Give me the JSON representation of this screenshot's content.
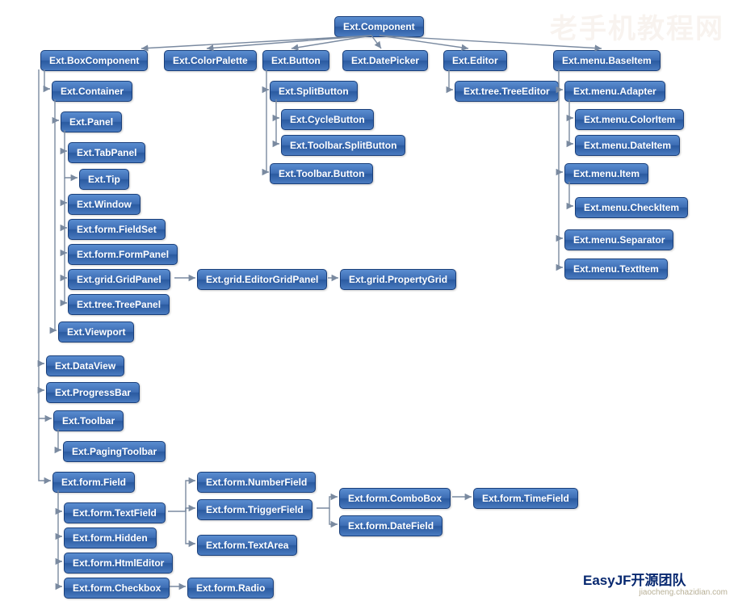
{
  "credit": "EasyJF开源团队",
  "watermark_small": "jiaocheng.chazidian.com",
  "watermark_big": "老手机教程网",
  "nodes": {
    "component": "Ext.Component",
    "boxcomponent": "Ext.BoxComponent",
    "colorpalette": "Ext.ColorPalette",
    "button": "Ext.Button",
    "datepicker": "Ext.DatePicker",
    "editor": "Ext.Editor",
    "menu_baseitem": "Ext.menu.BaseItem",
    "container": "Ext.Container",
    "panel": "Ext.Panel",
    "tabpanel": "Ext.TabPanel",
    "tip": "Ext.Tip",
    "window": "Ext.Window",
    "form_fieldset": "Ext.form.FieldSet",
    "form_formpanel": "Ext.form.FormPanel",
    "grid_gridpanel": "Ext.grid.GridPanel",
    "grid_editorgridpanel": "Ext.grid.EditorGridPanel",
    "grid_propertygrid": "Ext.grid.PropertyGrid",
    "tree_treepanel": "Ext.tree.TreePanel",
    "viewport": "Ext.Viewport",
    "splitbutton": "Ext.SplitButton",
    "cyclebutton": "Ext.CycleButton",
    "toolbar_splitbutton": "Ext.Toolbar.SplitButton",
    "toolbar_button": "Ext.Toolbar.Button",
    "tree_treeeditor": "Ext.tree.TreeEditor",
    "menu_adapter": "Ext.menu.Adapter",
    "menu_coloritem": "Ext.menu.ColorItem",
    "menu_dateitem": "Ext.menu.DateItem",
    "menu_item": "Ext.menu.Item",
    "menu_checkitem": "Ext.menu.CheckItem",
    "menu_separator": "Ext.menu.Separator",
    "menu_textitem": "Ext.menu.TextItem",
    "dataview": "Ext.DataView",
    "progressbar": "Ext.ProgressBar",
    "toolbar": "Ext.Toolbar",
    "pagingtoolbar": "Ext.PagingToolbar",
    "form_field": "Ext.form.Field",
    "form_textfield": "Ext.form.TextField",
    "form_hidden": "Ext.form.Hidden",
    "form_htmleditor": "Ext.form.HtmlEditor",
    "form_checkbox": "Ext.form.Checkbox",
    "form_numberfield": "Ext.form.NumberField",
    "form_triggerfield": "Ext.form.TriggerField",
    "form_textarea": "Ext.form.TextArea",
    "form_combobox": "Ext.form.ComboBox",
    "form_datefield": "Ext.form.DateField",
    "form_timefield": "Ext.form.TimeField",
    "form_radio": "Ext.form.Radio"
  },
  "hierarchy": {
    "root": "Ext.Component",
    "children": {
      "Ext.Component": [
        "Ext.BoxComponent",
        "Ext.ColorPalette",
        "Ext.Button",
        "Ext.DatePicker",
        "Ext.Editor",
        "Ext.menu.BaseItem"
      ],
      "Ext.BoxComponent": [
        "Ext.Container",
        "Ext.DataView",
        "Ext.ProgressBar",
        "Ext.Toolbar",
        "Ext.form.Field"
      ],
      "Ext.Container": [
        "Ext.Panel",
        "Ext.Viewport"
      ],
      "Ext.Panel": [
        "Ext.TabPanel",
        "Ext.Tip",
        "Ext.Window",
        "Ext.form.FieldSet",
        "Ext.form.FormPanel",
        "Ext.grid.GridPanel",
        "Ext.tree.TreePanel"
      ],
      "Ext.grid.GridPanel": [
        "Ext.grid.EditorGridPanel"
      ],
      "Ext.grid.EditorGridPanel": [
        "Ext.grid.PropertyGrid"
      ],
      "Ext.Button": [
        "Ext.SplitButton",
        "Ext.Toolbar.Button"
      ],
      "Ext.SplitButton": [
        "Ext.CycleButton",
        "Ext.Toolbar.SplitButton"
      ],
      "Ext.Editor": [
        "Ext.tree.TreeEditor"
      ],
      "Ext.menu.BaseItem": [
        "Ext.menu.Adapter",
        "Ext.menu.Item",
        "Ext.menu.Separator",
        "Ext.menu.TextItem"
      ],
      "Ext.menu.Adapter": [
        "Ext.menu.ColorItem",
        "Ext.menu.DateItem"
      ],
      "Ext.menu.Item": [
        "Ext.menu.CheckItem"
      ],
      "Ext.Toolbar": [
        "Ext.PagingToolbar"
      ],
      "Ext.form.Field": [
        "Ext.form.TextField",
        "Ext.form.Hidden",
        "Ext.form.HtmlEditor",
        "Ext.form.Checkbox"
      ],
      "Ext.form.TextField": [
        "Ext.form.NumberField",
        "Ext.form.TriggerField",
        "Ext.form.TextArea"
      ],
      "Ext.form.TriggerField": [
        "Ext.form.ComboBox",
        "Ext.form.DateField"
      ],
      "Ext.form.ComboBox": [
        "Ext.form.TimeField"
      ],
      "Ext.form.Checkbox": [
        "Ext.form.Radio"
      ]
    }
  }
}
